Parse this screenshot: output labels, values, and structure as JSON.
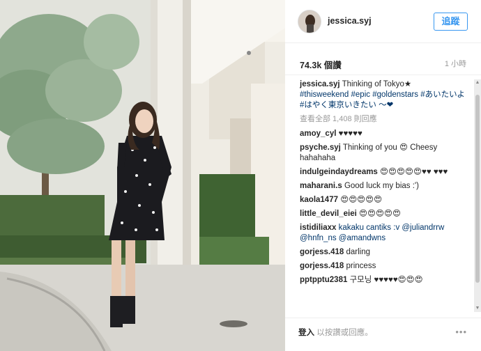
{
  "post": {
    "username": "jessica.syj",
    "follow_label": "追蹤",
    "likes": "74.3k 個讚",
    "time_ago": "1 小時",
    "caption": {
      "user": "jessica.syj",
      "text": "Thinking of Tokyo★",
      "tags_line1": "#thisweekend #epic #goldenstars #あいたいよ",
      "tags_line2": "#はやく東京いきたい 〜❤"
    },
    "view_all": "查看全部 1,408 則回應",
    "comments": [
      {
        "user": "amoy_cyl",
        "text": "♥♥♥♥♥"
      },
      {
        "user": "psyche.syj",
        "text": "Thinking of you 😍 Cheesy hahahaha"
      },
      {
        "user": "indulgeindaydreams",
        "text": "😍😍😍😍😍♥♥ ♥♥♥"
      },
      {
        "user": "maharani.s",
        "text": "Good luck my bias :')"
      },
      {
        "user": "kaola1477",
        "text": "😍😍😍😍😍"
      },
      {
        "user": "little_devil_eiei",
        "text": "😍😍😍😍😍"
      },
      {
        "user": "istidiliaxx",
        "text": "kakaku cantiks :v @juliandrrw @hnfn_ns @amandwns"
      },
      {
        "user": "gorjess.418",
        "text": "darling"
      },
      {
        "user": "gorjess.418",
        "text": "princess"
      },
      {
        "user": "pptpptu2381",
        "text": "구모닝 ♥♥♥♥♥😍😍😍"
      }
    ],
    "footer": {
      "login_link": "登入",
      "login_rest": " 以按讚或回應。",
      "more": "•••"
    }
  },
  "colors": {
    "accent": "#3897f0",
    "hashtag": "#003569",
    "muted": "#999999"
  }
}
